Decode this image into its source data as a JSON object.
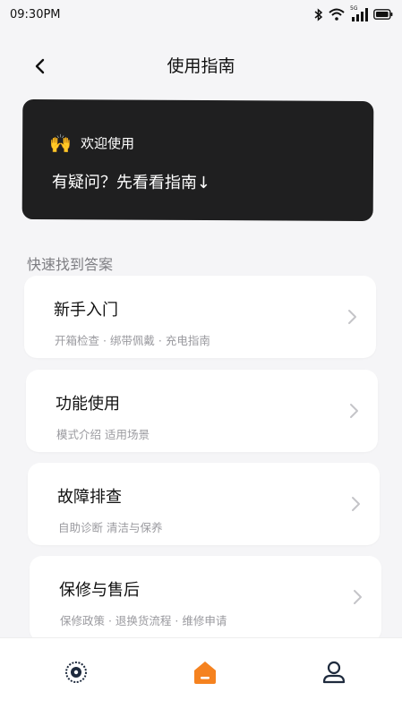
{
  "status_bar": {
    "time": "09:30PM",
    "signal_label": "5G"
  },
  "header": {
    "title": "使用指南"
  },
  "banner": {
    "welcome": "欢迎使用",
    "headline": "有疑问？先看看指南↓"
  },
  "section": {
    "label": "快速找到答案"
  },
  "cards": [
    {
      "title": "新手入门",
      "subtitle": "开箱检查 · 绑带佩戴 · 充电指南"
    },
    {
      "title": "功能使用",
      "subtitle": "模式介绍 适用场景"
    },
    {
      "title": "故障排查",
      "subtitle": "自助诊断 清洁与保养"
    },
    {
      "title": "保修与售后",
      "subtitle": "保修政策 · 退换货流程 · 维修申请"
    }
  ],
  "bottom_nav": {
    "items": [
      {
        "icon": "device-icon"
      },
      {
        "icon": "home-icon",
        "active": true
      },
      {
        "icon": "profile-icon"
      }
    ],
    "accent": "#f5821f"
  },
  "colors": {
    "banner_bg": "#1f1f20",
    "page_bg": "#f5f5f7",
    "muted": "#9a9a9f"
  }
}
